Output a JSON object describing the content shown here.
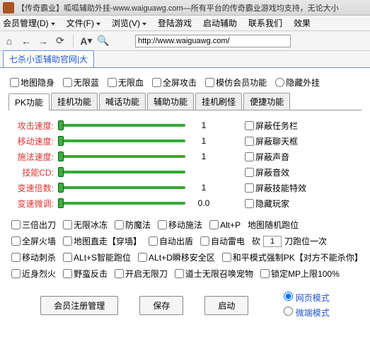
{
  "titlebar": {
    "text": "【传奇霸业】呱呱辅助外挂-www.waiguawg.com—所有平台的传奇霸业游戏均支持，无论大小"
  },
  "menubar": {
    "member": "会员管理(D)",
    "file": "文件(F)",
    "view": "浏览(V)",
    "login": "登陆游戏",
    "start": "启动辅助",
    "contact": "联系我们",
    "effect": "效果"
  },
  "url": "http://www.waiguawg.com/",
  "browser_tab": "七杀小歪辅助官网|大",
  "top_checks": {
    "c1": "地图隐身",
    "c2": "无限蓝",
    "c3": "无限血",
    "c4": "全屏攻击",
    "c5": "模仿会员功能",
    "hide": "隐藏外挂"
  },
  "subtabs": [
    "PK功能",
    "挂机功能",
    "喊话功能",
    "辅助功能",
    "挂机刷怪",
    "便捷功能"
  ],
  "sliders": {
    "atk": {
      "label": "攻击速度:",
      "val": "1"
    },
    "move": {
      "label": "移动速度:",
      "val": "1"
    },
    "cast": {
      "label": "施法速度:",
      "val": "1"
    },
    "cd": {
      "label": "技能CD:",
      "val": ""
    },
    "mult": {
      "label": "变速倍数:",
      "val": "1"
    },
    "fine": {
      "label": "变速微调:",
      "val": "0.0"
    }
  },
  "right_checks": {
    "r1": "屏蔽任务栏",
    "r2": "屏蔽聊天框",
    "r3": "屏蔽声音",
    "r4": "屏蔽音效",
    "r5": "屏蔽技能特效",
    "r6": "隐藏玩家"
  },
  "grid": {
    "row1": {
      "c1": "三倍出刀",
      "c2": "无限冰冻",
      "c3": "防魔法",
      "c4": "移动施法",
      "c5": "Alt+P",
      "c6": "地图随机跑位"
    },
    "row2": {
      "c1": "全屏火墙",
      "c2": "地图直走【穿墙】",
      "c3": "自动出盾",
      "c4": "自动雷电",
      "kan": "砍",
      "val": "1",
      "suffix": "刀跑位一次"
    },
    "row3": {
      "c1": "移动刺杀",
      "c2": "ALt+S智能跑位",
      "c3": "ALt+D瞬移安全区",
      "c4": "和平模式强制PK【对方不能杀你】"
    },
    "row4": {
      "c1": "近身烈火",
      "c2": "野蛮反击",
      "c3": "开启无限刀",
      "c4": "道士无限召唤宠物",
      "c5": "锁定MP上限100%"
    }
  },
  "buttons": {
    "b1": "会员注册管理",
    "b2": "保存",
    "b3": "启动"
  },
  "radios": {
    "r1": "网页模式",
    "r2": "微端模式"
  }
}
